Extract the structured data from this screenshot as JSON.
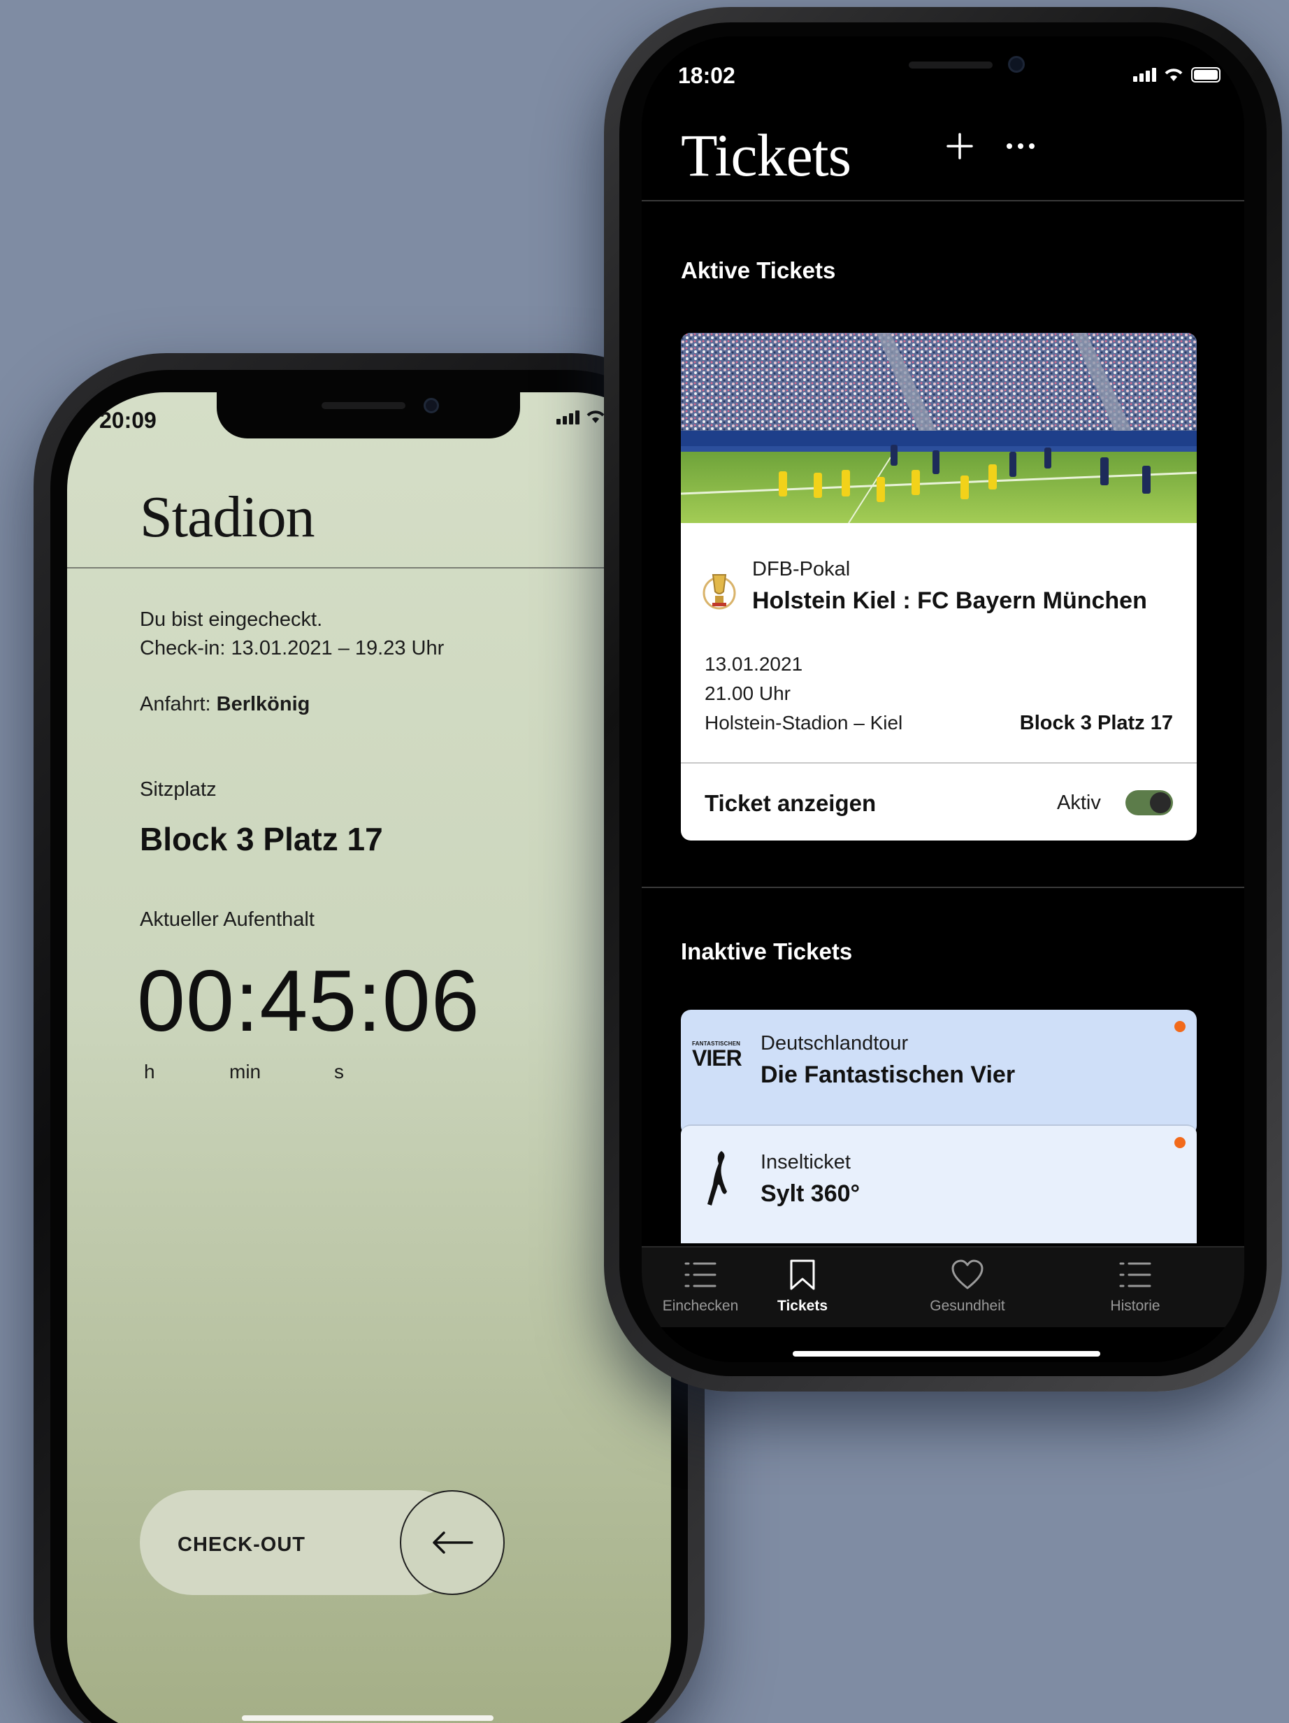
{
  "left_phone": {
    "status_time": "20:09",
    "title": "Stadion",
    "checkin_status": "Du bist eingecheckt.",
    "checkin_time": "Check-in: 13.01.2021 – 19.23 Uhr",
    "anfahrt_label": "Anfahrt:",
    "anfahrt_value": "Berlkönig",
    "seat_label": "Sitzplatz",
    "seat_value": "Block 3 Platz 17",
    "stay_label": "Aktueller Aufenthalt",
    "timer": "00:45:06",
    "units": {
      "h": "h",
      "min": "min",
      "s": "s"
    },
    "checkout_label": "CHECK-OUT",
    "checkout_icon": "arrow-left-icon"
  },
  "right_phone": {
    "status_time": "18:02",
    "title": "Tickets",
    "actions": [
      "plus-icon",
      "more-icon"
    ],
    "active_section": "Aktive Tickets",
    "active_ticket": {
      "competition": "DFB-Pokal",
      "match": "Holstein Kiel : FC Bayern München",
      "date": "13.01.2021",
      "time": "21.00 Uhr",
      "venue": "Holstein-Stadion – Kiel",
      "seat": "Block 3 Platz 17",
      "show_label": "Ticket anzeigen",
      "status_label": "Aktiv",
      "toggle_on": true
    },
    "inactive_section": "Inaktive Tickets",
    "inactive_tickets": [
      {
        "title": "Deutschlandtour",
        "name": "Die Fantastischen Vier",
        "logo_small": "FANTASTISCHEN",
        "logo_big": "VIER",
        "logo_icon": "fanta4-logo-icon"
      },
      {
        "title": "Inselticket",
        "name": "Sylt 360°",
        "logo_icon": "sylt-island-icon"
      }
    ],
    "tabs": [
      {
        "label": "Einchecken",
        "icon": "list-icon"
      },
      {
        "label": "Tickets",
        "icon": "bookmark-icon",
        "active": true
      },
      {
        "label": "Gesundheit",
        "icon": "heart-icon"
      },
      {
        "label": "Historie",
        "icon": "list-icon"
      }
    ]
  },
  "colors": {
    "background": "#7f8ca3",
    "stadion_screen": "#d5dec7",
    "toggle_active": "#5c7c4a",
    "notification_dot": "#f26a1b",
    "inactive_card": "#cfdff8"
  }
}
